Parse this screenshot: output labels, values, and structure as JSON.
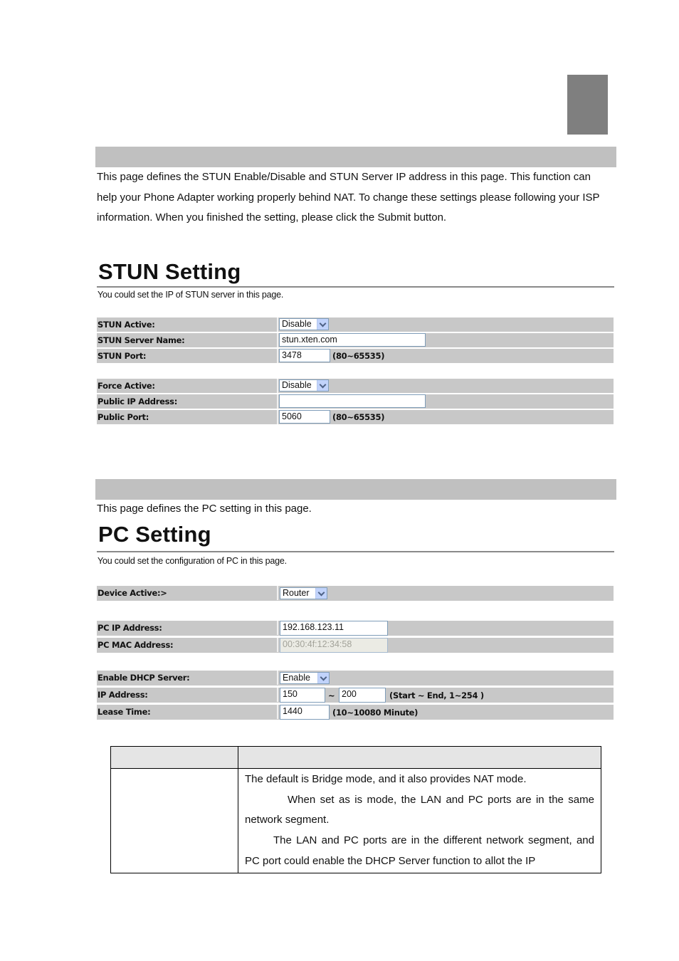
{
  "stun_section": {
    "intro": "This page defines the STUN Enable/Disable and STUN Server IP address in this page. This function can help your Phone Adapter working properly behind NAT. To change these settings please following your ISP information. When you finished the setting, please click the Submit button.",
    "ui_title": "STUN Setting",
    "ui_subtitle": "You could set the IP of STUN server in this page.",
    "rows": {
      "stun_active": {
        "label": "STUN Active:",
        "value": "Disable"
      },
      "stun_server_name": {
        "label": "STUN Server Name:",
        "value": "stun.xten.com"
      },
      "stun_port": {
        "label": "STUN Port:",
        "value": "3478",
        "hint": "(80~65535)"
      },
      "force_active": {
        "label": "Force Active:",
        "value": "Disable"
      },
      "public_ip": {
        "label": "Public IP Address:",
        "value": ""
      },
      "public_port": {
        "label": "Public Port:",
        "value": "5060",
        "hint": "(80~65535)"
      }
    }
  },
  "pc_section": {
    "intro": "This page defines the PC setting in this page.",
    "ui_title": "PC Setting",
    "ui_subtitle": "You could set the configuration of PC in this page.",
    "rows": {
      "device_active": {
        "label": "Device Active:>",
        "value": "Router"
      },
      "pc_ip": {
        "label": "PC IP Address:",
        "value": "192.168.123.11"
      },
      "pc_mac": {
        "label": "PC MAC Address:",
        "value": "00:30:4f:12:34:58"
      },
      "dhcp": {
        "label": "Enable DHCP Server:",
        "value": "Enable"
      },
      "ip_range": {
        "label": "IP Address:",
        "start": "150",
        "sep": "~",
        "end": "200",
        "hint": "(Start ~ End, 1~254 )"
      },
      "lease": {
        "label": "Lease Time:",
        "value": "1440",
        "hint": "(10~10080 Minute)"
      }
    }
  },
  "desc_table": {
    "header": [
      "",
      ""
    ],
    "row1_c1": "",
    "lines": [
      "The default is Bridge mode, and it also provides NAT mode.",
      "When set as is mode, the LAN and PC ports are in the same network segment.",
      "The LAN and PC ports are in the different network segment, and PC port could enable the DHCP Server function to allot the IP"
    ]
  }
}
